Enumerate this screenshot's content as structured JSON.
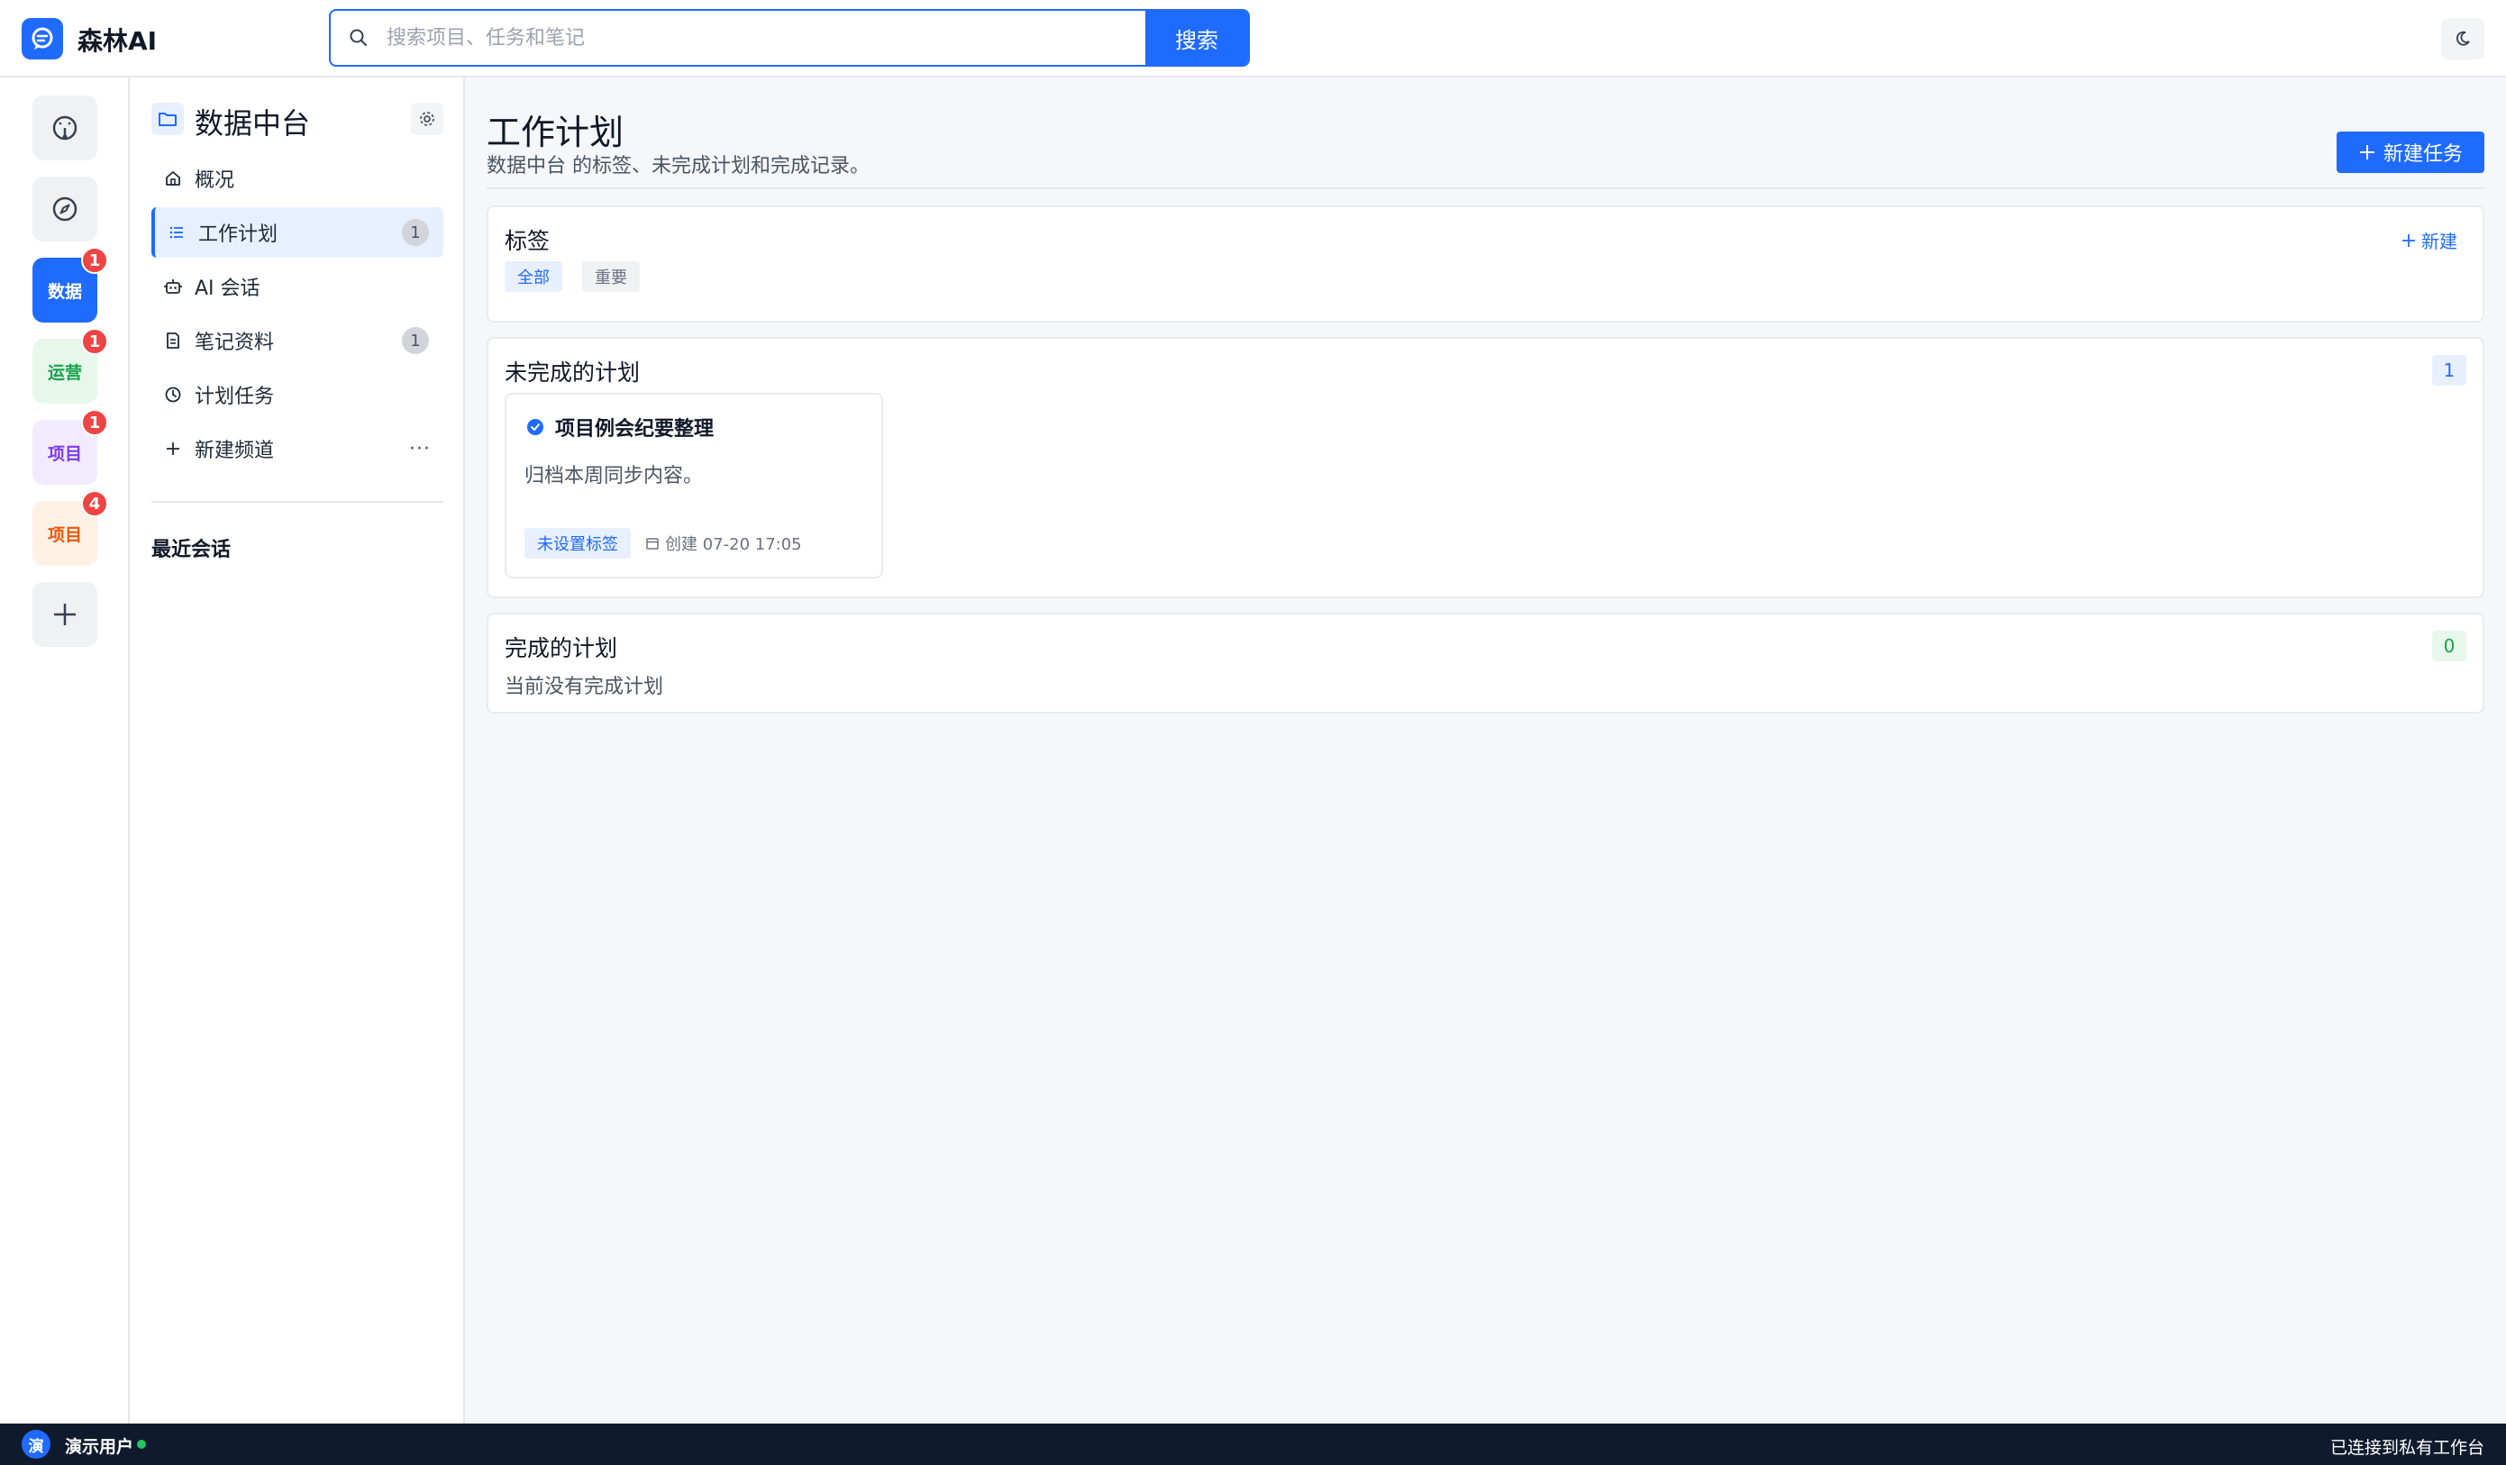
{
  "app": {
    "title": "森林AI"
  },
  "search": {
    "placeholder": "搜索项目、任务和笔记",
    "value": "",
    "button_label": "搜索"
  },
  "rail": {
    "items": [
      {
        "kind": "icon",
        "icon": "dashboard-icon"
      },
      {
        "kind": "icon",
        "icon": "compass-icon"
      },
      {
        "kind": "text",
        "label": "数据",
        "badge": "1",
        "bg": "#1f6bff",
        "fg": "#ffffff"
      },
      {
        "kind": "text",
        "label": "运营",
        "badge": "1",
        "bg": "#e7f7ec",
        "fg": "#16a34a"
      },
      {
        "kind": "text",
        "label": "项目",
        "badge": "1",
        "bg": "#f1ebfd",
        "fg": "#7c3aed"
      },
      {
        "kind": "text",
        "label": "项目",
        "badge": "4",
        "bg": "#fff1e4",
        "fg": "#ea580c"
      },
      {
        "kind": "icon",
        "icon": "plus-icon"
      }
    ]
  },
  "sidebar": {
    "title": "数据中台",
    "items": [
      {
        "label": "概况",
        "icon": "home-icon",
        "count": ""
      },
      {
        "label": "工作计划",
        "icon": "list-icon",
        "count": "1",
        "active": true
      },
      {
        "label": "AI 会话",
        "icon": "robot-icon",
        "count": ""
      },
      {
        "label": "笔记资料",
        "icon": "note-icon",
        "count": "1"
      },
      {
        "label": "计划任务",
        "icon": "clock-icon",
        "count": ""
      },
      {
        "label": "新建频道",
        "icon": "plus-icon",
        "more": "···"
      }
    ],
    "recent_label": "最近会话"
  },
  "main": {
    "title": "工作计划",
    "subtitle": "数据中台 的标签、未完成计划和完成记录。",
    "new_task_label": "新建任务",
    "tags_section": {
      "title": "标签",
      "new_label": "新建",
      "tags": [
        "全部",
        "重要"
      ]
    },
    "pending_section": {
      "title": "未完成的计划",
      "count": "1",
      "plans": [
        {
          "title": "项目例会纪要整理",
          "desc": "归档本周同步内容。",
          "tag": "未设置标签",
          "created": "创建 07-20 17:05"
        }
      ]
    },
    "done_section": {
      "title": "完成的计划",
      "count": "0",
      "empty_text": "当前没有完成计划"
    }
  },
  "status": {
    "avatar_text": "演",
    "user_name": "演示用户",
    "connection": "已连接到私有工作台"
  },
  "colors": {
    "accent": "#1f6bff",
    "badge": "#ef4444",
    "status_bar": "#0f1b2d",
    "online": "#22c55e"
  }
}
